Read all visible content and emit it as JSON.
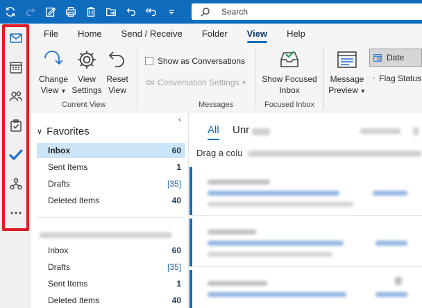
{
  "title_bar": {
    "search_placeholder": "Search",
    "quick_access_icons": [
      "sync-icon",
      "redo-icon",
      "compose-icon",
      "print-icon",
      "delete-icon",
      "move-icon",
      "undo-icon",
      "undo-all-icon",
      "customize-icon"
    ]
  },
  "nav_rail": {
    "items": [
      "mail-icon",
      "calendar-icon",
      "people-icon",
      "tasks-icon",
      "todo-icon",
      "groups-icon",
      "more-icon"
    ],
    "highlight_color": "#e21b22"
  },
  "ribbon": {
    "tabs": [
      "File",
      "Home",
      "Send / Receive",
      "Folder",
      "View",
      "Help"
    ],
    "active_tab": "View",
    "current_view": {
      "change_view_line1": "Change",
      "change_view_line2": "View",
      "view_settings_line1": "View",
      "view_settings_line2": "Settings",
      "reset_view_line1": "Reset",
      "reset_view_line2": "View",
      "group_label": "Current View"
    },
    "messages": {
      "show_as_conversations": "Show as Conversations",
      "conversation_settings": "Conversation Settings",
      "group_label": "Messages"
    },
    "focused_inbox": {
      "line1": "Show Focused",
      "line2": "Inbox",
      "group_label": "Focused Inbox"
    },
    "layout": {
      "message_preview_line1": "Message",
      "message_preview_line2": "Preview"
    },
    "arrangement": {
      "date": "Date",
      "flag_status": "Flag Status"
    }
  },
  "folder_pane": {
    "favorites_label": "Favorites",
    "favorites": [
      {
        "name": "Inbox",
        "count": "60",
        "selected": true
      },
      {
        "name": "Sent Items",
        "count": "1"
      },
      {
        "name": "Drafts",
        "count": "[35]"
      },
      {
        "name": "Deleted Items",
        "count": "40"
      }
    ],
    "account_folders": [
      {
        "name": "Inbox",
        "count": "60"
      },
      {
        "name": "Drafts",
        "count": "[35]"
      },
      {
        "name": "Sent Items",
        "count": "1"
      },
      {
        "name": "Deleted Items",
        "count": "40"
      }
    ]
  },
  "message_list": {
    "tab_all": "All",
    "tab_unread": "Unr",
    "drag_hint": "Drag a colu",
    "accent_color": "#0f6cbd"
  }
}
